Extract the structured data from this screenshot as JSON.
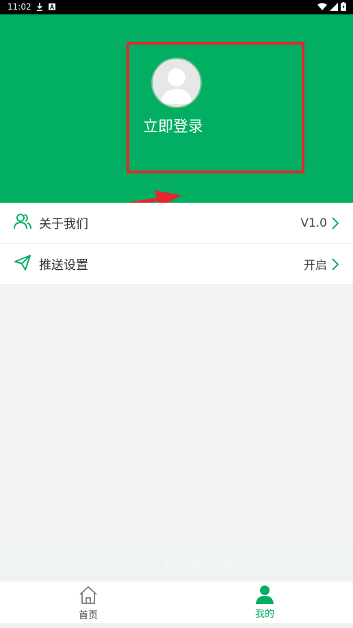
{
  "status_bar": {
    "time": "11:02"
  },
  "profile": {
    "login_label": "立即登录"
  },
  "menu": {
    "items": [
      {
        "label": "关于我们",
        "value": "V1.0",
        "icon": "users-icon"
      },
      {
        "label": "推送设置",
        "value": "开启",
        "icon": "send-icon"
      }
    ]
  },
  "footer": {
    "sponsor": "主办单位：天津市农业农村委员会"
  },
  "nav": {
    "home_label": "首页",
    "mine_label": "我的"
  },
  "colors": {
    "brand_green": "#02ae62",
    "highlight_red": "#e8252d"
  }
}
